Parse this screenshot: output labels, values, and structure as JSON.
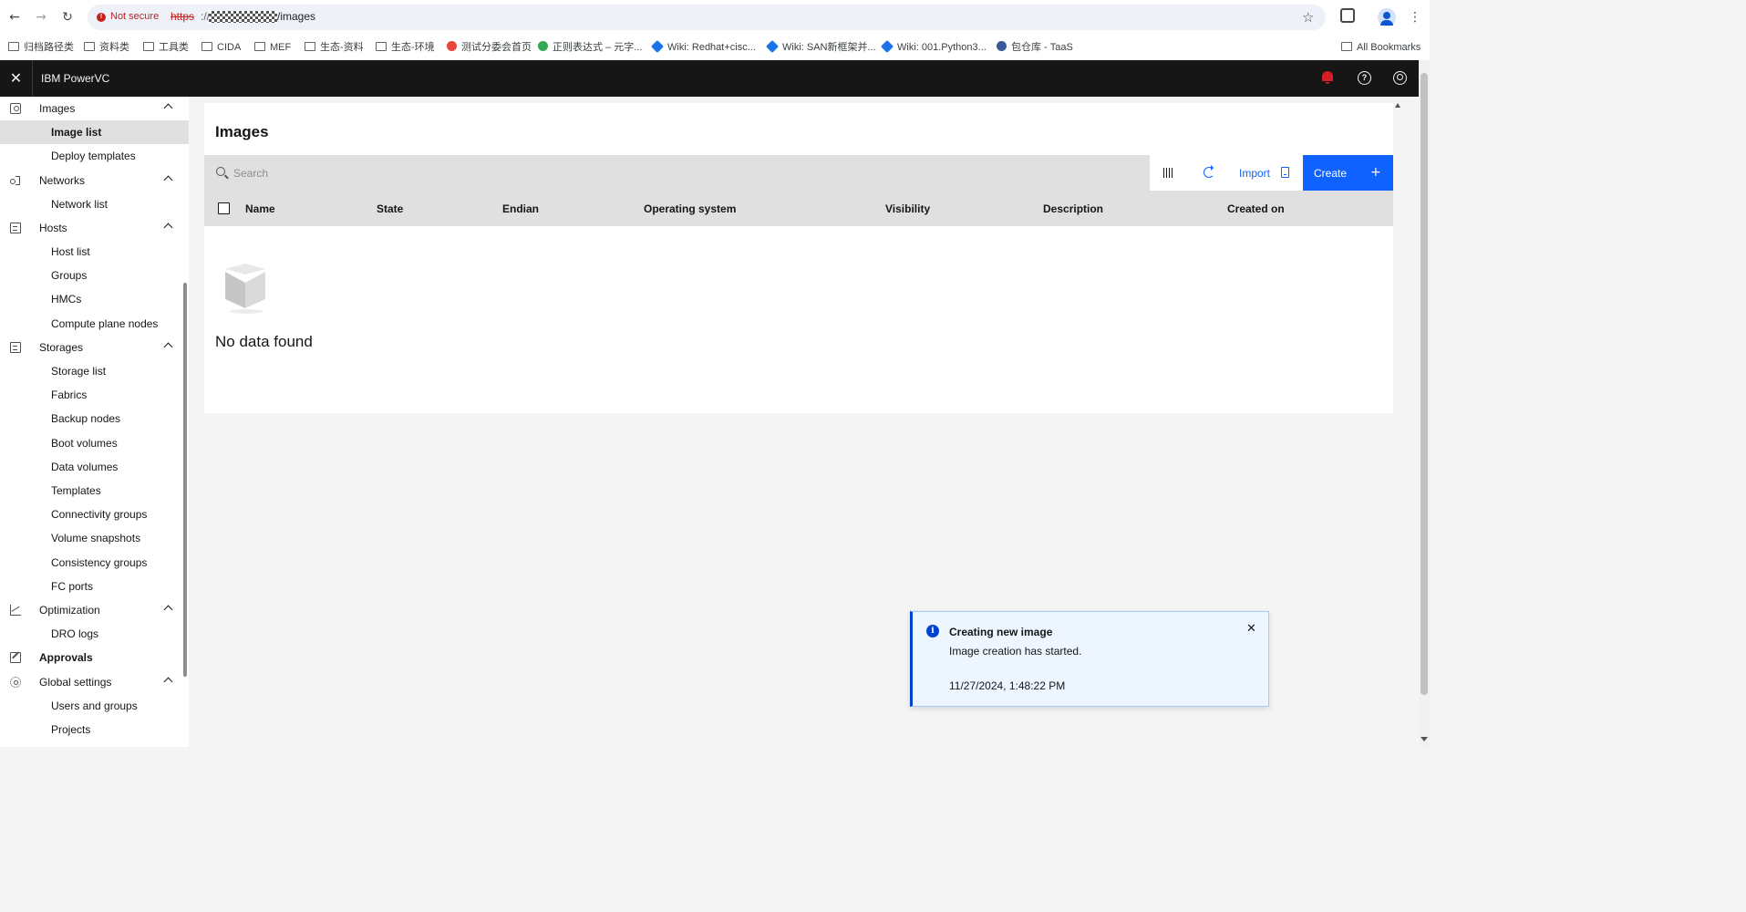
{
  "browser": {
    "security_label": "Not secure",
    "url_protocol": "https",
    "url_separator": "://",
    "url_path": "/images",
    "bookmarks": [
      "归档路径类",
      "资料类",
      "工具类",
      "CIDA",
      "MEF",
      "生态-资料",
      "生态-环境",
      "测试分委会首页",
      "正则表达式 – 元字...",
      "Wiki: Redhat+cisc...",
      "Wiki: SAN新框架并...",
      "Wiki: 001.Python3...",
      "包仓库 - TaaS"
    ],
    "all_bookmarks": "All Bookmarks"
  },
  "header": {
    "product_name": "IBM PowerVC"
  },
  "sidebar": {
    "images": {
      "label": "Images",
      "items": [
        "Image list",
        "Deploy templates"
      ]
    },
    "networks": {
      "label": "Networks",
      "items": [
        "Network list"
      ]
    },
    "hosts": {
      "label": "Hosts",
      "items": [
        "Host list",
        "Groups",
        "HMCs",
        "Compute plane nodes"
      ]
    },
    "storages": {
      "label": "Storages",
      "items": [
        "Storage list",
        "Fabrics",
        "Backup nodes",
        "Boot volumes",
        "Data volumes",
        "Templates",
        "Connectivity groups",
        "Volume snapshots",
        "Consistency groups",
        "FC ports"
      ]
    },
    "optimization": {
      "label": "Optimization",
      "items": [
        "DRO logs"
      ]
    },
    "approvals": {
      "label": "Approvals"
    },
    "global_settings": {
      "label": "Global settings",
      "items": [
        "Users and groups",
        "Projects"
      ]
    }
  },
  "main": {
    "title": "Images",
    "search_placeholder": "Search",
    "import_label": "Import",
    "create_label": "Create",
    "columns": [
      "Name",
      "State",
      "Endian",
      "Operating system",
      "Visibility",
      "Description",
      "Created on"
    ],
    "empty_message": "No data found"
  },
  "toast": {
    "title": "Creating new image",
    "subtitle": "Image creation has started.",
    "timestamp": "11/27/2024, 1:48:22 PM"
  },
  "colors": {
    "accent": "#0f62fe",
    "header_bg": "#161616",
    "notification": "#da1e28",
    "toast_border": "#0043ce"
  }
}
